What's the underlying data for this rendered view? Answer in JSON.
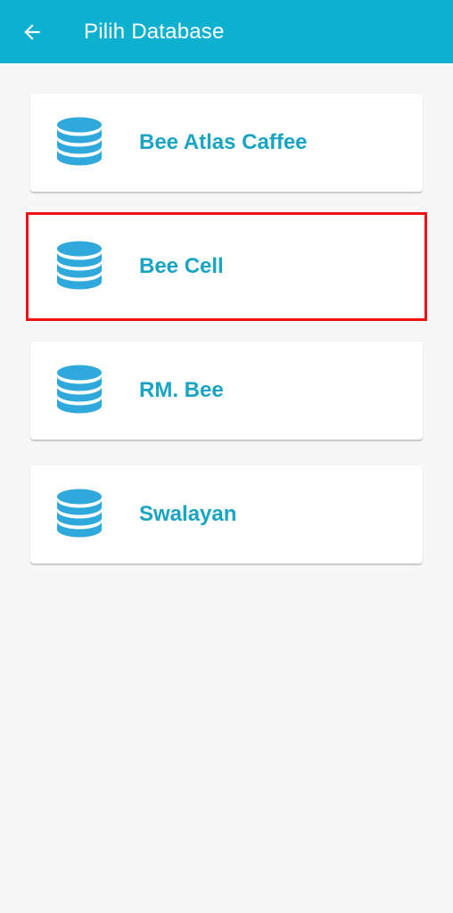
{
  "header": {
    "title": "Pilih Database",
    "back_icon": "arrow-left-icon",
    "background": "#0eb0d0"
  },
  "databases": [
    {
      "label": "Bee Atlas Caffee",
      "icon": "database-icon",
      "selected": false
    },
    {
      "label": "Bee Cell",
      "icon": "database-icon",
      "selected": true
    },
    {
      "label": "RM. Bee",
      "icon": "database-icon",
      "selected": false
    },
    {
      "label": "Swalayan",
      "icon": "database-icon",
      "selected": false
    }
  ],
  "colors": {
    "accent_text": "#1aa4c4",
    "icon": "#2fa8dc",
    "selection_outline": "#ee1111"
  }
}
